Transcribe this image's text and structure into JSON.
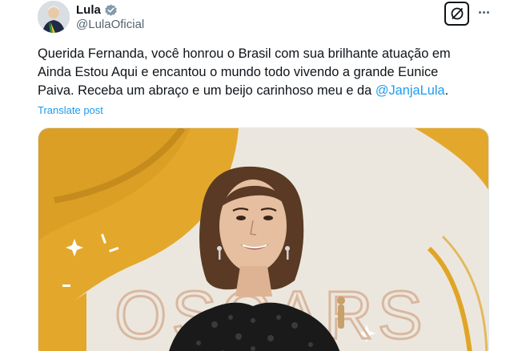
{
  "author": {
    "display_name": "Lula",
    "handle": "@LulaOficial",
    "verified_icon": "verified-badge-icon",
    "avatar_icon": "profile-photo-avatar"
  },
  "actions": {
    "grok_icon": "grok-icon",
    "more_icon": "more-dots-icon"
  },
  "tweet": {
    "line_1": "Querida Fernanda, você honrou o Brasil com sua brilhante atuação em",
    "line_2": "Ainda Estou Aqui e encantou o mundo todo vivendo a grande Eunice",
    "line_3_prefix": "Paiva. Receba um abraço e um beijo carinhoso meu e da ",
    "mention": "@JanjaLula",
    "line_3_suffix": ".",
    "translate_label": "Translate post"
  },
  "media": {
    "backdrop_text": "OSCARS",
    "colors": {
      "gold": "#e0a526",
      "backdrop": "#ece7de",
      "hair": "#5a3a24",
      "dress": "#1a1a1a"
    }
  }
}
